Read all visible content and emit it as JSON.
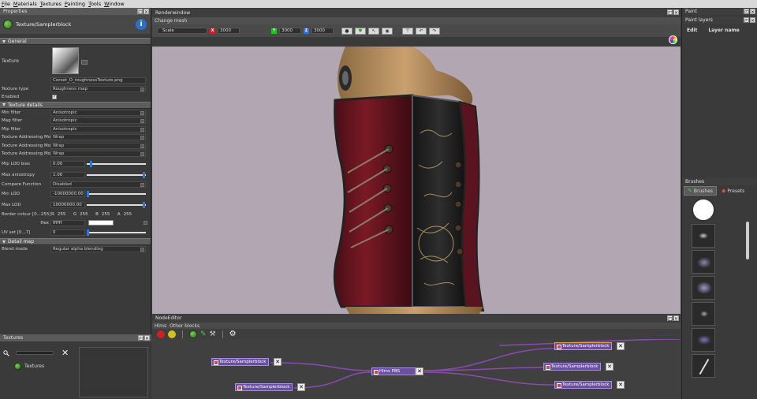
{
  "menu": [
    "File",
    "Materials",
    "Textures",
    "Painting",
    "Tools",
    "Window"
  ],
  "properties": {
    "title": "Properties",
    "object_name": "Texture/Samplerblock",
    "section_general": "General",
    "texture_label": "Texture",
    "texture_filename": "Corset_O_roughnessTexture.png",
    "texture_type_label": "Texture type",
    "texture_type_value": "Roughness map",
    "enabled_label": "Enabled",
    "section_details": "Texture details",
    "details": [
      {
        "label": "Min filter",
        "value": "Anisotropic"
      },
      {
        "label": "Mag filter",
        "value": "Anisotropic"
      },
      {
        "label": "Mip filter",
        "value": "Anisotropic"
      },
      {
        "label": "Texture Addressing Mode U",
        "value": "Wrap"
      },
      {
        "label": "Texture Addressing Mode V",
        "value": "Wrap"
      },
      {
        "label": "Texture Addressing Mode W",
        "value": "Wrap"
      }
    ],
    "mip_lod_bias_label": "Mip LOD bias",
    "mip_lod_bias_value": "0.00",
    "mip_lod_bias_level": 0.05,
    "max_aniso_label": "Max anisotropy",
    "max_aniso_value": "1.00",
    "max_aniso_level": 0.98,
    "compare_label": "Compare Function",
    "compare_value": "Disabled",
    "min_lod_label": "Min LOD",
    "min_lod_value": "-10000000.00",
    "min_lod_level": 0.0,
    "max_lod_label": "Max LOD",
    "max_lod_value": "10000000.00",
    "max_lod_level": 0.98,
    "border_label": "Border colour [0...255]",
    "r_label": "R",
    "r_value": "255",
    "g_label": "G",
    "g_value": "255",
    "b_label": "B",
    "b_value": "255",
    "a_label": "A",
    "a_value": "255",
    "hex_label": "Hex",
    "hex_value": "ffffff",
    "uv_label": "UV set [0...7]",
    "uv_value": "0",
    "uv_level": 0.0,
    "section_detail_map": "Detail map",
    "blend_label": "Blend mode",
    "blend_value": "Regular alpha blending"
  },
  "textures_panel": {
    "title": "Textures",
    "item": "Textures"
  },
  "renderwindow": {
    "title": "Renderwindow",
    "change_mesh": "Change mesh",
    "scale_label": "Scale",
    "x_label": "X",
    "x_value": "3000",
    "y_label": "Y",
    "y_value": "3000",
    "z_label": "Z",
    "z_value": "3000"
  },
  "nodeeditor": {
    "title": "NodeEditor",
    "tabs": [
      "Hlms",
      "Other blocks"
    ],
    "nodes": [
      {
        "label": "Texture/Samplerblock"
      },
      {
        "label": "Texture/Samplerblock"
      },
      {
        "label": "Hlms PBS"
      },
      {
        "label": "Texture/Samplerblock"
      },
      {
        "label": "Texture/Samplerblock"
      },
      {
        "label": "Texture/Samplerblock"
      }
    ]
  },
  "paint": {
    "title": "Paint",
    "layers_title": "Paint layers",
    "edit_label": "Edit",
    "layer_name_label": "Layer name"
  },
  "brushes": {
    "title": "Brushes",
    "tab_brushes": "Brushes",
    "tab_presets": "Presets"
  },
  "colors": {
    "accent": "#2a7ad6",
    "node": "#6b4fa0",
    "viewport": "#b3a6b3"
  }
}
